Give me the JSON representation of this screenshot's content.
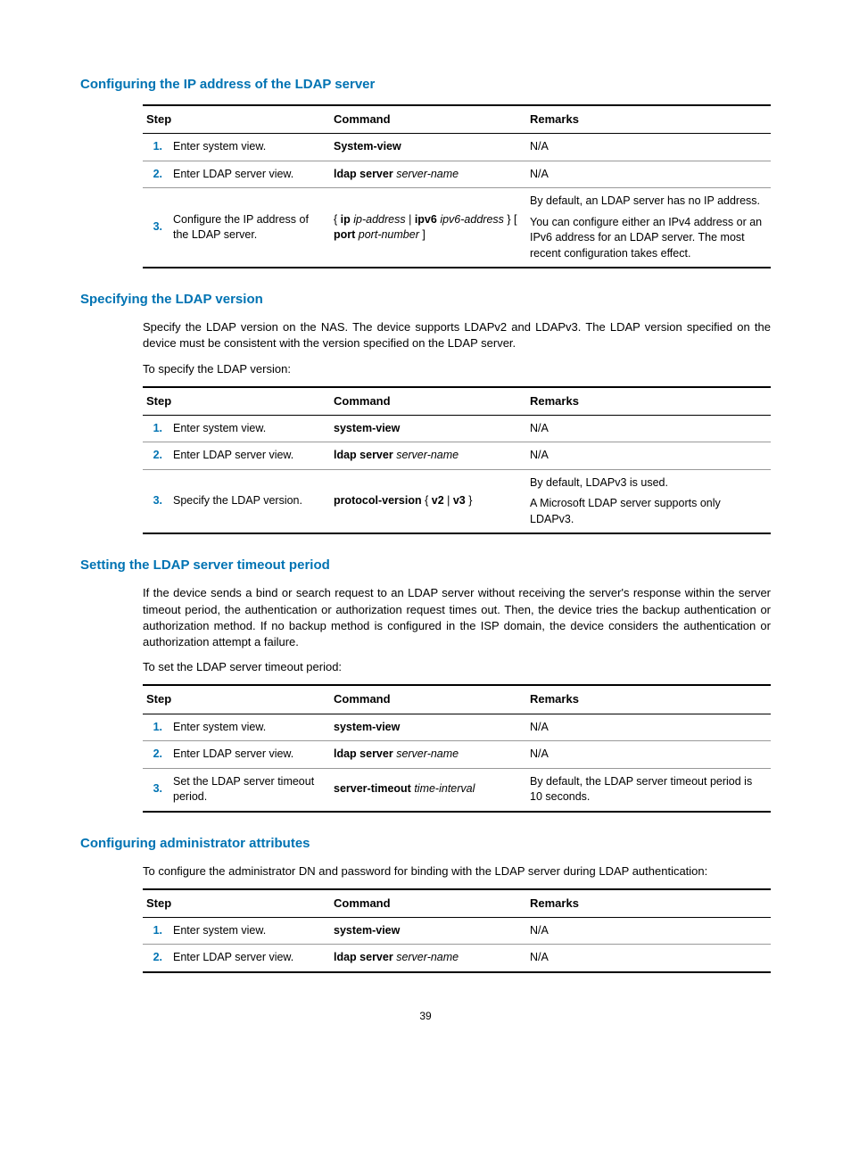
{
  "sections": [
    {
      "heading": "Configuring the IP address of the LDAP server",
      "paragraphs": [],
      "table": {
        "headers": {
          "step": "Step",
          "command": "Command",
          "remarks": "Remarks"
        },
        "rows": [
          {
            "num": "1.",
            "step": "Enter system view.",
            "command_parts": [
              {
                "text": "System-view",
                "style": "bold"
              }
            ],
            "remarks_blocks": [
              "N/A"
            ]
          },
          {
            "num": "2.",
            "step": "Enter LDAP server view.",
            "command_parts": [
              {
                "text": "ldap server ",
                "style": "bold"
              },
              {
                "text": "server-name",
                "style": "italic"
              }
            ],
            "remarks_blocks": [
              "N/A"
            ]
          },
          {
            "num": "3.",
            "step": "Configure the IP address of the LDAP server.",
            "command_parts": [
              {
                "text": "{ ",
                "style": ""
              },
              {
                "text": "ip ",
                "style": "bold"
              },
              {
                "text": "ip-address",
                "style": "italic"
              },
              {
                "text": " | ",
                "style": ""
              },
              {
                "text": "ipv6 ",
                "style": "bold"
              },
              {
                "text": "ipv6-address",
                "style": "italic"
              },
              {
                "text": " } [ ",
                "style": ""
              },
              {
                "text": "port ",
                "style": "bold"
              },
              {
                "text": "port-number",
                "style": "italic"
              },
              {
                "text": " ]",
                "style": ""
              }
            ],
            "remarks_blocks": [
              "By default, an LDAP server has no IP address.",
              "You can configure either an IPv4 address or an IPv6 address for an LDAP server. The most recent configuration takes effect."
            ]
          }
        ]
      }
    },
    {
      "heading": "Specifying the LDAP version",
      "paragraphs": [
        "Specify the LDAP version on the NAS. The device supports LDAPv2 and LDAPv3. The LDAP version specified on the device must be consistent with the version specified on the LDAP server.",
        "To specify the LDAP version:"
      ],
      "table": {
        "headers": {
          "step": "Step",
          "command": "Command",
          "remarks": "Remarks"
        },
        "rows": [
          {
            "num": "1.",
            "step": "Enter system view.",
            "command_parts": [
              {
                "text": "system-view",
                "style": "bold"
              }
            ],
            "remarks_blocks": [
              "N/A"
            ]
          },
          {
            "num": "2.",
            "step": "Enter LDAP server view.",
            "command_parts": [
              {
                "text": "ldap server ",
                "style": "bold"
              },
              {
                "text": "server-name",
                "style": "italic"
              }
            ],
            "remarks_blocks": [
              "N/A"
            ]
          },
          {
            "num": "3.",
            "step": "Specify the LDAP version.",
            "command_parts": [
              {
                "text": "protocol-version ",
                "style": "bold"
              },
              {
                "text": "{ ",
                "style": ""
              },
              {
                "text": "v2",
                "style": "bold"
              },
              {
                "text": " | ",
                "style": ""
              },
              {
                "text": "v3",
                "style": "bold"
              },
              {
                "text": " }",
                "style": ""
              }
            ],
            "remarks_blocks": [
              "By default, LDAPv3 is used.",
              "A Microsoft LDAP server supports only LDAPv3."
            ]
          }
        ]
      }
    },
    {
      "heading": "Setting the LDAP server timeout period",
      "paragraphs": [
        "If the device sends a bind or search request to an LDAP server without receiving the server's response within the server timeout period, the authentication or authorization request times out. Then, the device tries the backup authentication or authorization method. If no backup method is configured in the ISP domain, the device considers the authentication or authorization attempt a failure.",
        "To set the LDAP server timeout period:"
      ],
      "table": {
        "headers": {
          "step": "Step",
          "command": "Command",
          "remarks": "Remarks"
        },
        "rows": [
          {
            "num": "1.",
            "step": "Enter system view.",
            "command_parts": [
              {
                "text": "system-view",
                "style": "bold"
              }
            ],
            "remarks_blocks": [
              "N/A"
            ]
          },
          {
            "num": "2.",
            "step": "Enter LDAP server view.",
            "command_parts": [
              {
                "text": "ldap server ",
                "style": "bold"
              },
              {
                "text": "server-name",
                "style": "italic"
              }
            ],
            "remarks_blocks": [
              "N/A"
            ]
          },
          {
            "num": "3.",
            "step": "Set the LDAP server timeout period.",
            "command_parts": [
              {
                "text": "server-timeout ",
                "style": "bold"
              },
              {
                "text": "time-interval",
                "style": "italic"
              }
            ],
            "remarks_blocks": [
              "By default, the LDAP server timeout period is 10 seconds."
            ]
          }
        ]
      }
    },
    {
      "heading": "Configuring administrator attributes",
      "paragraphs": [
        "To configure the administrator DN and password for binding with the LDAP server during LDAP authentication:"
      ],
      "table": {
        "headers": {
          "step": "Step",
          "command": "Command",
          "remarks": "Remarks"
        },
        "rows": [
          {
            "num": "1.",
            "step": "Enter system view.",
            "command_parts": [
              {
                "text": "system-view",
                "style": "bold"
              }
            ],
            "remarks_blocks": [
              "N/A"
            ]
          },
          {
            "num": "2.",
            "step": "Enter LDAP server view.",
            "command_parts": [
              {
                "text": "ldap server ",
                "style": "bold"
              },
              {
                "text": "server-name",
                "style": "italic"
              }
            ],
            "remarks_blocks": [
              "N/A"
            ]
          }
        ]
      }
    }
  ],
  "page_number": "39"
}
